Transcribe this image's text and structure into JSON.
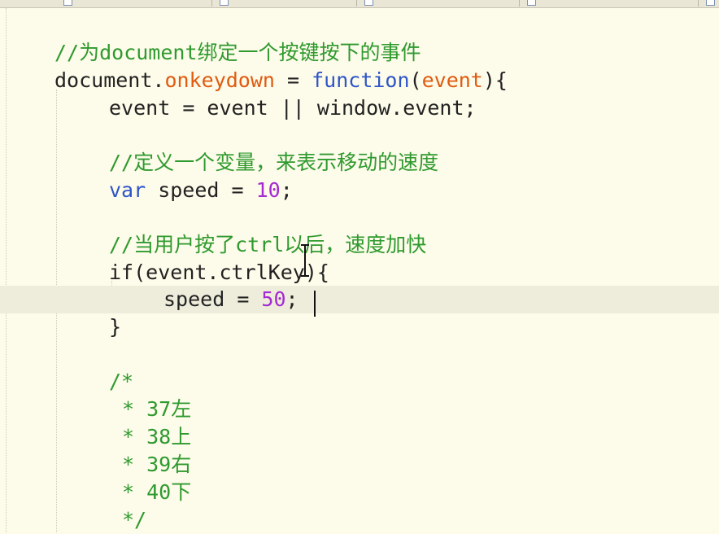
{
  "tabs": [
    "",
    "",
    "",
    "",
    ""
  ],
  "code": {
    "line1_comment": "//为document绑定一个按键按下的事件",
    "line2": {
      "obj": "document",
      "dot": ".",
      "prop": "onkeydown",
      "assign": " = ",
      "kw": "function",
      "open": "(",
      "param": "event",
      "close": "){"
    },
    "line3": {
      "lhs": "event",
      "assign": " = ",
      "a": "event",
      "or": " || ",
      "b": "window.event",
      "end": ";"
    },
    "line4_comment": "//定义一个变量，来表示移动的速度",
    "line5": {
      "kw": "var",
      "name": " speed",
      "assign": " = ",
      "num": "10",
      "end": ";"
    },
    "line6_comment": "//当用户按了ctrl以后，速度加快",
    "line7": {
      "kw": "if",
      "open": "(",
      "expr": "event.ctrlKey",
      "close": "){"
    },
    "line8": {
      "name": "speed",
      "assign": " = ",
      "num": "50",
      "end": ";"
    },
    "line9": "}",
    "block_comment": [
      "/*",
      "* 37左",
      "* 38上",
      "* 39右",
      "* 40下",
      "*/"
    ]
  }
}
